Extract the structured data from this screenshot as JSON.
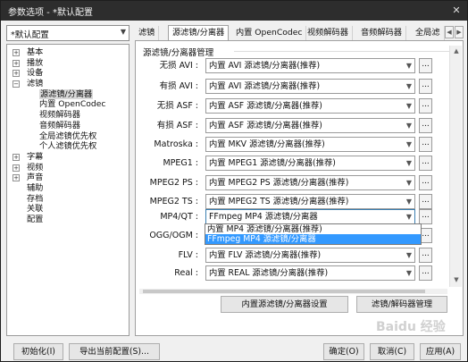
{
  "window": {
    "title": "参数选项 - *默认配置",
    "controls": {
      "close": "✕"
    }
  },
  "profile": {
    "value": "*默认配置"
  },
  "tree": [
    {
      "label": "基本",
      "exp": "+"
    },
    {
      "label": "播放",
      "exp": "+"
    },
    {
      "label": "设备",
      "exp": "+"
    },
    {
      "label": "滤镜",
      "exp": "−"
    },
    {
      "label": "源滤镜/分离器",
      "child": true,
      "selected": true
    },
    {
      "label": "内置 OpenCodec",
      "child": true
    },
    {
      "label": "视频解码器",
      "child": true
    },
    {
      "label": "音频解码器",
      "child": true
    },
    {
      "label": "全局滤镜优先权",
      "child": true
    },
    {
      "label": "个人滤镜优先权",
      "child": true
    },
    {
      "label": "字幕",
      "exp": "+"
    },
    {
      "label": "视频",
      "exp": "+"
    },
    {
      "label": "声音",
      "exp": "+"
    },
    {
      "label": "辅助"
    },
    {
      "label": "存档"
    },
    {
      "label": "关联"
    },
    {
      "label": "配置"
    }
  ],
  "tabs": [
    "滤镜",
    "源滤镜/分离器",
    "内置 OpenCodec",
    "视频解码器",
    "音频解码器",
    "全局滤"
  ],
  "tab_nav": {
    "prev": "◀",
    "next": "▶"
  },
  "panel": {
    "group_title": "源滤镜/分离器管理",
    "rows": [
      {
        "label": "无损 AVI :",
        "value": "内置 AVI 源滤镜/分离器(推荐)"
      },
      {
        "label": "有损 AVI :",
        "value": "内置 AVI 源滤镜/分离器(推荐)"
      },
      {
        "label": "无损 ASF :",
        "value": "内置 ASF 源滤镜/分离器(推荐)"
      },
      {
        "label": "有损 ASF :",
        "value": "内置 ASF 源滤镜/分离器(推荐)"
      },
      {
        "label": "Matroska :",
        "value": "内置 MKV 源滤镜/分离器(推荐)"
      },
      {
        "label": "MPEG1 :",
        "value": "内置 MPEG1 源滤镜/分离器(推荐)"
      },
      {
        "label": "MPEG2 PS :",
        "value": "内置 MPEG2 PS 源滤镜/分离器(推荐)"
      },
      {
        "label": "MPEG2 TS :",
        "value": "内置 MPEG2 TS 源滤镜/分离器(推荐)"
      },
      {
        "label": "MP4/QT :",
        "value": "FFmpeg MP4 源滤镜/分离器"
      },
      {
        "label": "OGG/OGM :",
        "value": ""
      },
      {
        "label": "FLV :",
        "value": "内置 FLV 源滤镜/分离器(推荐)"
      },
      {
        "label": "Real :",
        "value": "内置 REAL 源滤镜/分离器(推荐)"
      }
    ],
    "dots": "...",
    "dropdown_options": [
      "内置 MP4 源滤镜/分离器(推荐)",
      "FFmpeg MP4 源滤镜/分离器"
    ],
    "builtin_settings_button": "内置源滤镜/分离器设置",
    "filter_manager_button": "滤镜/解码器管理"
  },
  "footer": {
    "init_button": "初始化(I)",
    "export_button": "导出当前配置(S)...",
    "ok_button": "确定(O)",
    "cancel_button": "取消(C)",
    "apply_button": "应用(A)"
  },
  "watermark": "Baidu 经验"
}
